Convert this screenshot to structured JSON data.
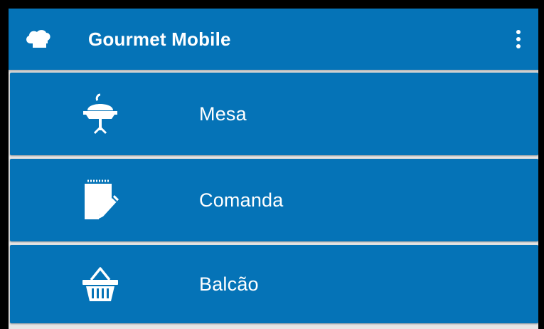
{
  "app": {
    "title": "Gourmet Mobile",
    "logo_icon": "chef-hat-icon",
    "overflow_icon": "more-vert-icon"
  },
  "colors": {
    "primary": "#0573b7",
    "primary_light": "#0a7bbf",
    "background": "#e6e6e6",
    "text": "#ffffff"
  },
  "menu": {
    "items": [
      {
        "label": "Mesa",
        "icon": "table-cloche-icon"
      },
      {
        "label": "Comanda",
        "icon": "notepad-pencil-icon"
      },
      {
        "label": "Balcão",
        "icon": "basket-icon"
      }
    ]
  }
}
